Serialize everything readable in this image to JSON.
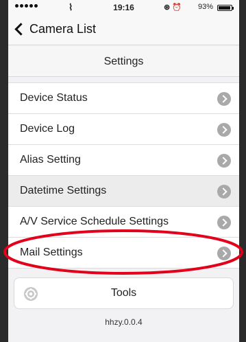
{
  "status_bar": {
    "time": "19:16",
    "battery_percent": "93%",
    "status_icons": "⊛ ⏰"
  },
  "nav": {
    "back_label": "Camera List"
  },
  "header": {
    "title": "Settings"
  },
  "menu": {
    "items": [
      {
        "label": "Device Status"
      },
      {
        "label": "Device Log"
      },
      {
        "label": "Alias Setting"
      },
      {
        "label": "Datetime Settings"
      },
      {
        "label": "A/V Service Schedule Settings"
      },
      {
        "label": "Mail Settings"
      }
    ]
  },
  "tools": {
    "label": "Tools"
  },
  "footer": {
    "version": "hhzy.0.0.4"
  },
  "colors": {
    "highlight_row": "#ececec",
    "annotation_circle": "#e2001a",
    "disclosure": "#a9a9a9"
  }
}
